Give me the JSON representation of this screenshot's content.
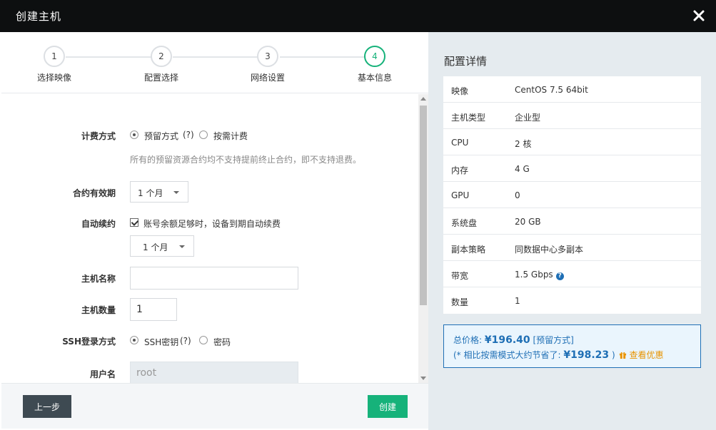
{
  "window": {
    "title": "创建主机"
  },
  "steps": [
    {
      "number": "1",
      "label": "选择映像"
    },
    {
      "number": "2",
      "label": "配置选择"
    },
    {
      "number": "3",
      "label": "网络设置"
    },
    {
      "number": "4",
      "label": "基本信息"
    }
  ],
  "form": {
    "billing": {
      "label": "计费方式",
      "option_reserved": "预留方式",
      "option_reserved_help": "(?)",
      "option_ondemand": "按需计费",
      "hint": "所有的预留资源合约均不支持提前终止合约，即不支持退费。"
    },
    "contract": {
      "label": "合约有效期",
      "value": "1 个月"
    },
    "auto_renew": {
      "label": "自动续约",
      "checkbox_text": "账号余额足够时，设备到期自动续费",
      "value": "1 个月"
    },
    "host_name": {
      "label": "主机名称",
      "value": ""
    },
    "host_count": {
      "label": "主机数量",
      "value": "1"
    },
    "ssh": {
      "label": "SSH登录方式",
      "option_key": "SSH密钥",
      "option_key_help": "(?)",
      "option_password": "密码"
    },
    "username": {
      "label": "用户名",
      "value": "root"
    }
  },
  "footer": {
    "prev_label": "上一步",
    "create_label": "创建"
  },
  "summary": {
    "heading": "配置详情",
    "rows": [
      {
        "key": "映像",
        "value": "CentOS 7.5 64bit"
      },
      {
        "key": "主机类型",
        "value": "企业型"
      },
      {
        "key": "CPU",
        "value": "2 核"
      },
      {
        "key": "内存",
        "value": "4 G"
      },
      {
        "key": "GPU",
        "value": "0"
      },
      {
        "key": "系统盘",
        "value": "20 GB"
      },
      {
        "key": "副本策略",
        "value": "同数据中心多副本"
      },
      {
        "key": "带宽",
        "value": "1.5 Gbps"
      },
      {
        "key": "数量",
        "value": "1"
      }
    ],
    "price": {
      "total_label": "总价格: ",
      "total_value": "¥196.40",
      "total_mode": " [预留方式]",
      "save_prefix": "(* 相比按需模式大约节省了: ",
      "save_value": "¥198.23",
      "save_suffix": " )",
      "offer_link": "查看优惠"
    }
  },
  "colors": {
    "accent_green": "#16b27a",
    "accent_blue": "#1f6fb5",
    "offer_orange": "#e89400",
    "titlebar": "#0d0f10"
  }
}
